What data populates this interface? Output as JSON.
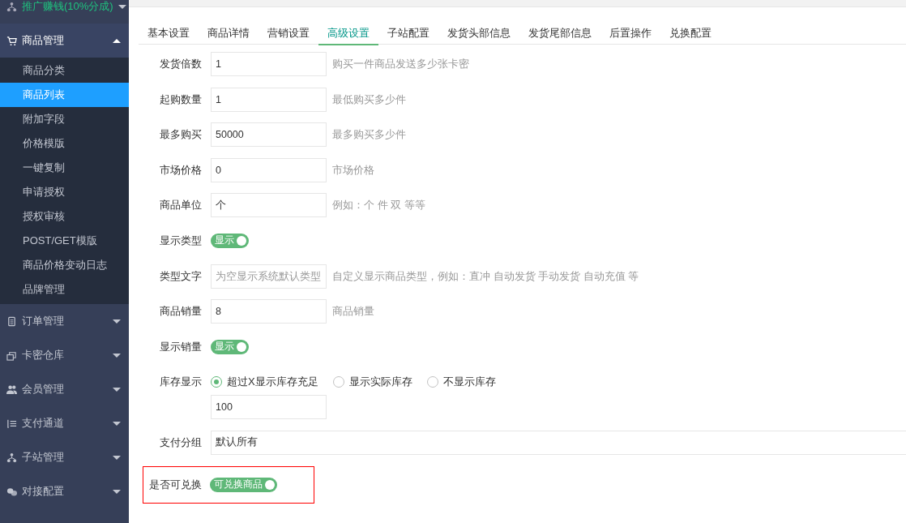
{
  "sidebar": {
    "promo": {
      "label": "推广赚钱(10%分成)"
    },
    "groups": [
      {
        "label": "商品管理",
        "expanded": true,
        "children": [
          {
            "label": "商品分类",
            "selected": false
          },
          {
            "label": "商品列表",
            "selected": true
          },
          {
            "label": "附加字段",
            "selected": false
          },
          {
            "label": "价格模版",
            "selected": false
          },
          {
            "label": "一键复制",
            "selected": false
          },
          {
            "label": "申请授权",
            "selected": false
          },
          {
            "label": "授权审核",
            "selected": false
          },
          {
            "label": "POST/GET模版",
            "selected": false
          },
          {
            "label": "商品价格变动日志",
            "selected": false
          },
          {
            "label": "品牌管理",
            "selected": false
          }
        ]
      },
      {
        "label": "订单管理",
        "expanded": false
      },
      {
        "label": "卡密仓库",
        "expanded": false
      },
      {
        "label": "会员管理",
        "expanded": false
      },
      {
        "label": "支付通道",
        "expanded": false
      },
      {
        "label": "子站管理",
        "expanded": false
      },
      {
        "label": "对接配置",
        "expanded": false
      }
    ]
  },
  "tabs": [
    {
      "label": "基本设置",
      "selected": false
    },
    {
      "label": "商品详情",
      "selected": false
    },
    {
      "label": "营销设置",
      "selected": false
    },
    {
      "label": "高级设置",
      "selected": true
    },
    {
      "label": "子站配置",
      "selected": false
    },
    {
      "label": "发货头部信息",
      "selected": false
    },
    {
      "label": "发货尾部信息",
      "selected": false
    },
    {
      "label": "后置操作",
      "selected": false
    },
    {
      "label": "兑换配置",
      "selected": false
    }
  ],
  "form": [
    {
      "kind": "input",
      "label": "发货倍数",
      "value": "1",
      "hint": "购买一件商品发送多少张卡密"
    },
    {
      "kind": "input",
      "label": "起购数量",
      "value": "1",
      "hint": "最低购买多少件"
    },
    {
      "kind": "input",
      "label": "最多购买",
      "value": "50000",
      "hint": "最多购买多少件"
    },
    {
      "kind": "input",
      "label": "市场价格",
      "value": "0",
      "hint": "市场价格"
    },
    {
      "kind": "input",
      "label": "商品单位",
      "value": "个",
      "hint": "例如：个 件 双 等等"
    },
    {
      "kind": "switch",
      "label": "显示类型",
      "on": true,
      "text": "显示"
    },
    {
      "kind": "input",
      "label": "类型文字",
      "placeholder": "为空显示系统默认类型",
      "hint": "自定义显示商品类型，例如：直冲 自动发货 手动发货 自动充值 等"
    },
    {
      "kind": "input",
      "label": "商品销量",
      "value": "8",
      "hint": "商品销量"
    },
    {
      "kind": "switch",
      "label": "显示销量",
      "on": true,
      "text": "显示"
    },
    {
      "kind": "radio",
      "label": "库存显示",
      "options": [
        {
          "label": "超过X显示库存充足",
          "selected": true
        },
        {
          "label": "显示实际库存",
          "selected": false
        },
        {
          "label": "不显示库存",
          "selected": false
        }
      ],
      "value": "100"
    },
    {
      "kind": "select",
      "label": "支付分组",
      "value": "默认所有"
    },
    {
      "kind": "switch",
      "label": "是否可兑换",
      "on": true,
      "text": "可兑换商品",
      "highlighted": true
    }
  ]
}
